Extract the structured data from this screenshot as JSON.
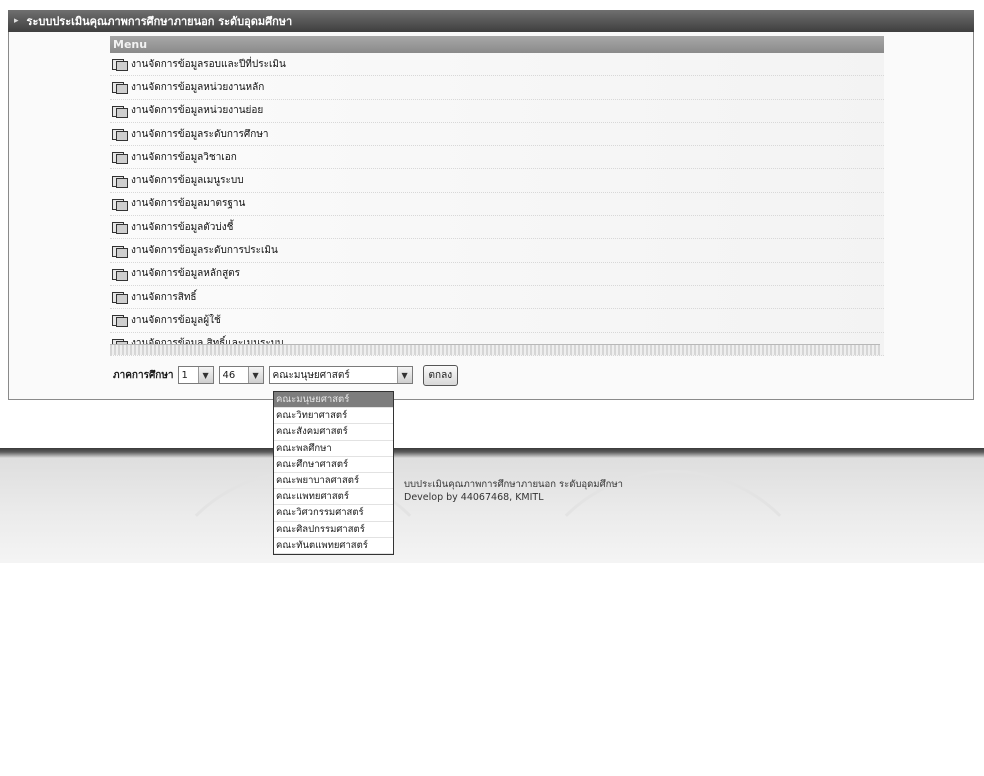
{
  "title_bar": {
    "title": "ระบบประเมินคุณภาพการศึกษาภายนอก ระดับอุดมศึกษา"
  },
  "menu": {
    "header": "Menu",
    "items": [
      {
        "label": "งานจัดการข้อมูลรอบและปีที่ประเมิน"
      },
      {
        "label": "งานจัดการข้อมูลหน่วยงานหลัก"
      },
      {
        "label": "งานจัดการข้อมูลหน่วยงานย่อย"
      },
      {
        "label": "งานจัดการข้อมูลระดับการศึกษา"
      },
      {
        "label": "งานจัดการข้อมูลวิชาเอก"
      },
      {
        "label": "งานจัดการข้อมูลเมนูระบบ"
      },
      {
        "label": "งานจัดการข้อมูลมาตรฐาน"
      },
      {
        "label": "งานจัดการข้อมูลตัวบ่งชี้"
      },
      {
        "label": "งานจัดการข้อมูลระดับการประเมิน"
      },
      {
        "label": "งานจัดการข้อมูลหลักสูตร"
      },
      {
        "label": "งานจัดการสิทธิ์"
      },
      {
        "label": "งานจัดการข้อมูลผู้ใช้"
      },
      {
        "label": "งานจัดการข้อมูล สิทธิ์และเมนูระบบ"
      }
    ]
  },
  "filter": {
    "label": "ภาคการศึกษา",
    "term_value": "1",
    "year_value": "46",
    "faculty_value": "คณะมนุษยศาสตร์",
    "submit_label": "ตกลง"
  },
  "dropdown": {
    "options": [
      {
        "label": "คณะมนุษยศาสตร์"
      },
      {
        "label": "คณะวิทยาศาสตร์"
      },
      {
        "label": "คณะสังคมศาสตร์"
      },
      {
        "label": "คณะพลศึกษา"
      },
      {
        "label": "คณะศึกษาศาสตร์"
      },
      {
        "label": "คณะพยาบาลศาสตร์"
      },
      {
        "label": "คณะแพทยศาสตร์"
      },
      {
        "label": "คณะวิศวกรรมศาสตร์"
      },
      {
        "label": "คณะศิลปกรรมศาสตร์"
      },
      {
        "label": "คณะทันตแพทยศาสตร์"
      }
    ]
  },
  "footer": {
    "line1": "บบประเมินคุณภาพการศึกษาภายนอก ระดับอุดมศึกษา",
    "line2": "Develop by 44067468, KMITL"
  }
}
